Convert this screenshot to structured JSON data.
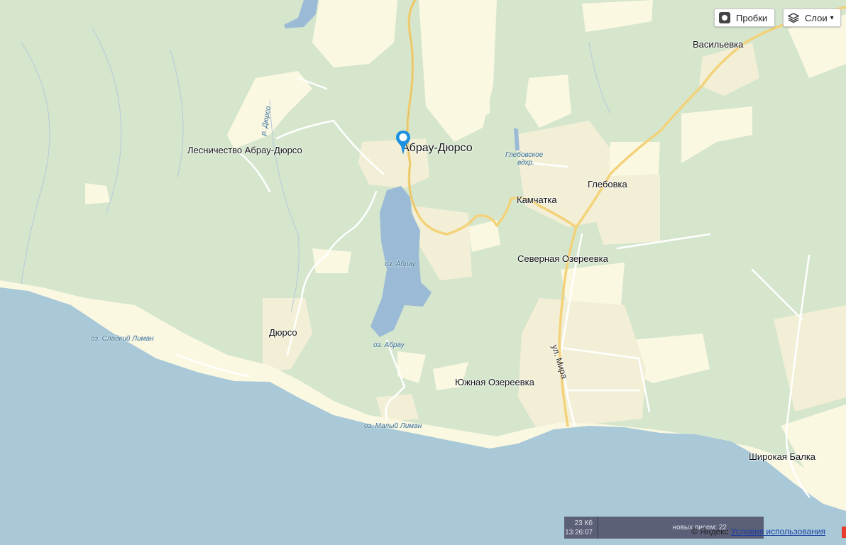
{
  "controls": {
    "traffic_label": "Пробки",
    "layers_label": "Слои",
    "traffic_icon": "traffic-light-icon",
    "layers_icon": "layers-icon",
    "layers_chevron": "chevron-down-icon"
  },
  "places": {
    "abrau_dyurso": "Абрау-Дюрсо",
    "forestry": "Лесничество Абрау-Дюрсо",
    "dyurso": "Дюрсо",
    "vasilyevka": "Васильевка",
    "glebovka": "Глебовка",
    "kamchatka": "Камчатка",
    "sev_ozereevka": "Северная Озереевка",
    "yuzh_ozereevka": "Южная Озереевка",
    "shirokaya_balka": "Широкая Балка"
  },
  "water": {
    "lake_abrau_1": "оз. Абрау",
    "lake_abrau_2": "оз. Абрау",
    "sladkiy_liman": "оз. Сладкий Лиман",
    "maliy_liman": "оз. Малый Лиман",
    "river_dyurso": "р. Дюрсо",
    "glebovskoe_1": "Глебовское",
    "glebovskoe_2": "вдхр."
  },
  "streets": {
    "mira": "ул. Мира"
  },
  "status": {
    "size": "23 Кб",
    "time": "13:26:07",
    "messages": "новых писем: 22"
  },
  "footer": {
    "copyright": "© Яндекс",
    "terms": "Условия использования"
  },
  "colors": {
    "sea": "#a9c9d9",
    "forest": "#d5e6cd",
    "settlement": "#f3efd6",
    "open_land": "#fbf8e2",
    "road_major": "#f3d27a",
    "pin": "#1e90e0"
  }
}
